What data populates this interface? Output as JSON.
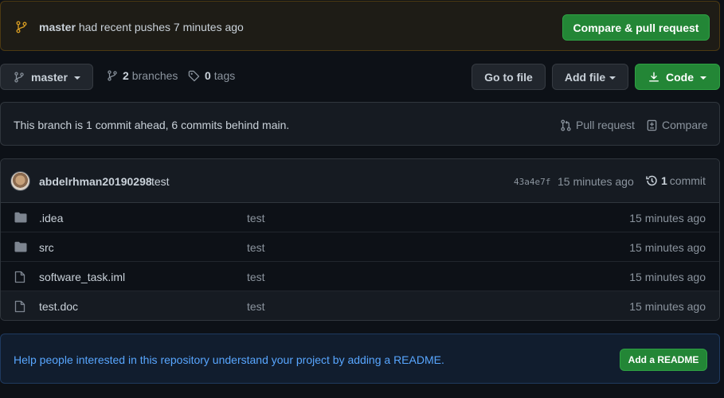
{
  "push_banner": {
    "branch": "master",
    "message": "had recent pushes 7 minutes ago",
    "button": "Compare & pull request"
  },
  "toolbar": {
    "branch": "master",
    "branches_count": "2",
    "branches_label": "branches",
    "tags_count": "0",
    "tags_label": "tags",
    "go_to_file": "Go to file",
    "add_file": "Add file",
    "code": "Code"
  },
  "ahead_behind": {
    "text": "This branch is 1 commit ahead, 6 commits behind main.",
    "pull_request": "Pull request",
    "compare": "Compare"
  },
  "latest_commit": {
    "author": "abdelrhman20190298",
    "message": "test",
    "sha": "43a4e7f",
    "time": "15 minutes ago",
    "count": "1",
    "count_label": "commit"
  },
  "files": [
    {
      "name": ".idea",
      "type": "folder",
      "message": "test",
      "age": "15 minutes ago"
    },
    {
      "name": "src",
      "type": "folder",
      "message": "test",
      "age": "15 minutes ago"
    },
    {
      "name": "software_task.iml",
      "type": "file",
      "message": "test",
      "age": "15 minutes ago"
    },
    {
      "name": "test.doc",
      "type": "file",
      "message": "test",
      "age": "15 minutes ago"
    }
  ],
  "readme": {
    "text": "Help people interested in this repository understand your project by adding a README.",
    "button": "Add a README"
  },
  "colors": {
    "background": "#0d1117",
    "green_button": "#238636",
    "link_blue": "#58a6ff",
    "banner_branch_icon": "#d29922"
  }
}
